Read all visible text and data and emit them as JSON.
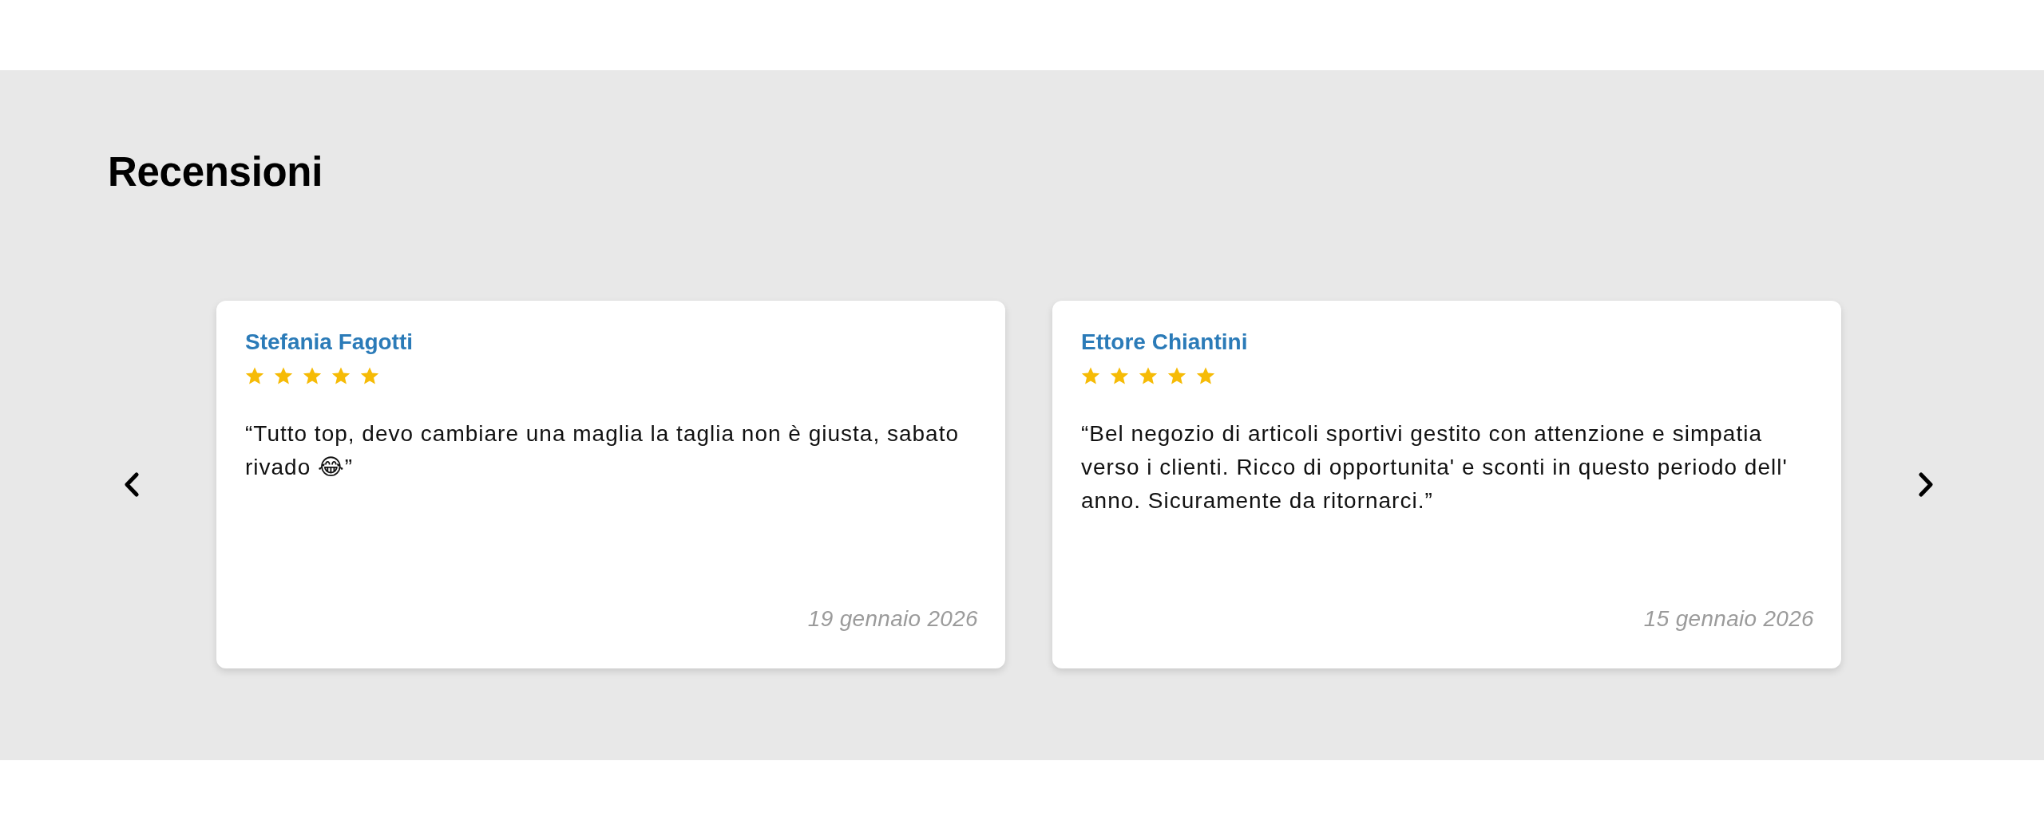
{
  "section": {
    "title": "Recensioni"
  },
  "reviews": [
    {
      "author": "Stefania Fagotti",
      "stars": 5,
      "text": "“Tutto top, devo cambiare una maglia la taglia non è giusta, sabato rivado 😂”",
      "date": "19 gennaio 2026"
    },
    {
      "author": "Ettore Chiantini",
      "stars": 5,
      "text": "“Bel negozio di articoli sportivi gestito con attenzione e simpatia verso i clienti. Ricco di opportunita' e sconti in questo periodo dell' anno. Sicuramente da ritornarci.”",
      "date": "15 gennaio 2026"
    }
  ]
}
